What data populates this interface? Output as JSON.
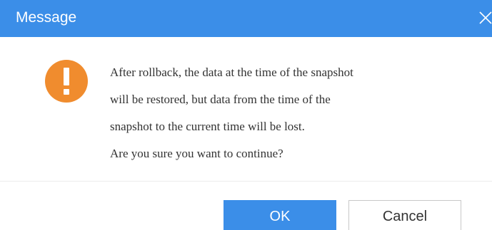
{
  "dialog": {
    "title": "Message",
    "close_icon": "close-icon",
    "warning_icon": "exclamation-warning-icon",
    "message_lines": [
      "After rollback, the data at the time of the snapshot",
      "will be restored, but data from the time of the",
      "snapshot to the current time will be lost.",
      "Are you sure you want to continue?"
    ],
    "buttons": {
      "ok_label": "OK",
      "cancel_label": "Cancel"
    }
  },
  "colors": {
    "accent": "#3b8ee8",
    "warning": "#f08c2e",
    "text": "#333333"
  }
}
